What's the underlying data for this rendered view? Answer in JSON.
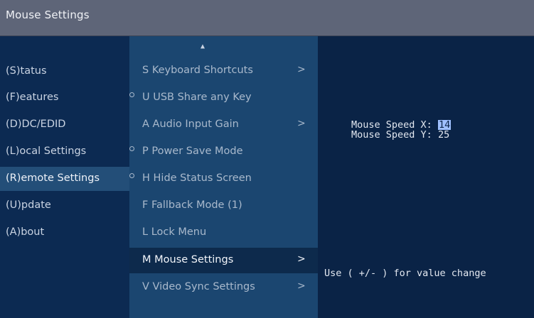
{
  "window": {
    "title": "Mouse Settings"
  },
  "left_menu": {
    "items": [
      {
        "label": "(S)tatus"
      },
      {
        "label": "(F)eatures"
      },
      {
        "label": "(D)DC/EDID"
      },
      {
        "label": "(L)ocal   Settings"
      },
      {
        "label": "(R)emote Settings"
      },
      {
        "label": "(U)pdate"
      },
      {
        "label": "(A)bout"
      }
    ],
    "active_index": 4
  },
  "sub_menu": {
    "scroll_up_icon": "up-arrow-icon",
    "items": [
      {
        "label": "S Keyboard Shortcuts",
        "submenu": ">"
      },
      {
        "label": "U USB Share any Key"
      },
      {
        "label": "A Audio Input Gain",
        "submenu": ">"
      },
      {
        "label": "P Power Save Mode"
      },
      {
        "label": "H Hide Status Screen"
      },
      {
        "label": "F Fallback Mode (1)"
      },
      {
        "label": "L Lock Menu"
      },
      {
        "label": "M Mouse Settings",
        "submenu": ">"
      },
      {
        "label": "V Video Sync Settings",
        "submenu": ">"
      }
    ],
    "active_index": 7
  },
  "mouse_settings": {
    "speed_x": {
      "label": "Mouse Speed X:",
      "value": "14"
    },
    "speed_y": {
      "label": "Mouse Speed Y:",
      "value": "25"
    },
    "hint": "Use ( +/- ) for value change"
  },
  "colors": {
    "title_bar": "#5e6578",
    "left_panel": "#0c2a52",
    "sub_panel": "#1b4670",
    "detail_panel": "#0a2346",
    "highlight": "#234e78",
    "selected_value": "#9fc0ff"
  }
}
